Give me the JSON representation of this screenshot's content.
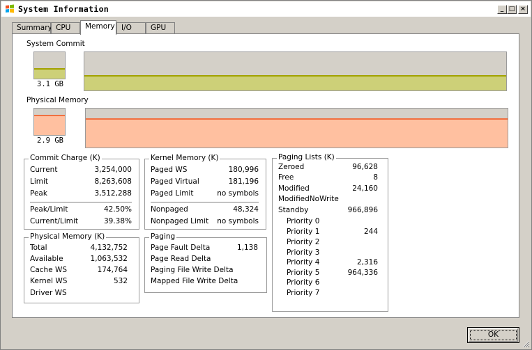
{
  "window": {
    "title": "System Information"
  },
  "tabs": [
    {
      "label": "Summary"
    },
    {
      "label": "CPU"
    },
    {
      "label": "Memory"
    },
    {
      "label": "I/O"
    },
    {
      "label": "GPU"
    }
  ],
  "active_tab": "Memory",
  "system_commit": {
    "label": "System Commit",
    "value": "3.1 GB",
    "level_fraction": 0.38,
    "color": "#cdd078",
    "line_color": "#a2a200"
  },
  "physical_memory_meter": {
    "label": "Physical Memory",
    "value": "2.9 GB",
    "level_fraction": 0.74,
    "color": "#ffc0a0",
    "line_color": "#f07040"
  },
  "commit_charge": {
    "title": "Commit Charge (K)",
    "rows": [
      {
        "label": "Current",
        "value": "3,254,000"
      },
      {
        "label": "Limit",
        "value": "8,263,608"
      },
      {
        "label": "Peak",
        "value": "3,512,288"
      }
    ],
    "ratios": [
      {
        "label": "Peak/Limit",
        "value": "42.50%"
      },
      {
        "label": "Current/Limit",
        "value": "39.38%"
      }
    ]
  },
  "kernel_memory": {
    "title": "Kernel Memory (K)",
    "rows": [
      {
        "label": "Paged WS",
        "value": "180,996"
      },
      {
        "label": "Paged Virtual",
        "value": "181,196"
      },
      {
        "label": "Paged Limit",
        "value": "no symbols"
      }
    ],
    "rows2": [
      {
        "label": "Nonpaged",
        "value": "48,324"
      },
      {
        "label": "Nonpaged Limit",
        "value": "no symbols"
      }
    ]
  },
  "paging_lists": {
    "title": "Paging Lists (K)",
    "rows": [
      {
        "label": "Zeroed",
        "value": "96,628"
      },
      {
        "label": "Free",
        "value": "8"
      },
      {
        "label": "Modified",
        "value": "24,160"
      },
      {
        "label": "ModifiedNoWrite",
        "value": ""
      },
      {
        "label": "Standby",
        "value": "966,896"
      }
    ],
    "priorities": [
      {
        "label": "Priority 0",
        "value": ""
      },
      {
        "label": "Priority 1",
        "value": "244"
      },
      {
        "label": "Priority 2",
        "value": ""
      },
      {
        "label": "Priority 3",
        "value": ""
      },
      {
        "label": "Priority 4",
        "value": "2,316"
      },
      {
        "label": "Priority 5",
        "value": "964,336"
      },
      {
        "label": "Priority 6",
        "value": ""
      },
      {
        "label": "Priority 7",
        "value": ""
      }
    ]
  },
  "physical_memory": {
    "title": "Physical Memory (K)",
    "rows": [
      {
        "label": "Total",
        "value": "4,132,752"
      },
      {
        "label": "Available",
        "value": "1,063,532"
      },
      {
        "label": "Cache WS",
        "value": "174,764"
      },
      {
        "label": "Kernel WS",
        "value": "532"
      },
      {
        "label": "Driver WS",
        "value": ""
      }
    ]
  },
  "paging": {
    "title": "Paging",
    "rows": [
      {
        "label": "Page Fault Delta",
        "value": "1,138"
      },
      {
        "label": "Page Read Delta",
        "value": ""
      },
      {
        "label": "Paging File Write Delta",
        "value": ""
      },
      {
        "label": "Mapped File Write Delta",
        "value": ""
      }
    ]
  },
  "buttons": {
    "ok": "OK"
  }
}
